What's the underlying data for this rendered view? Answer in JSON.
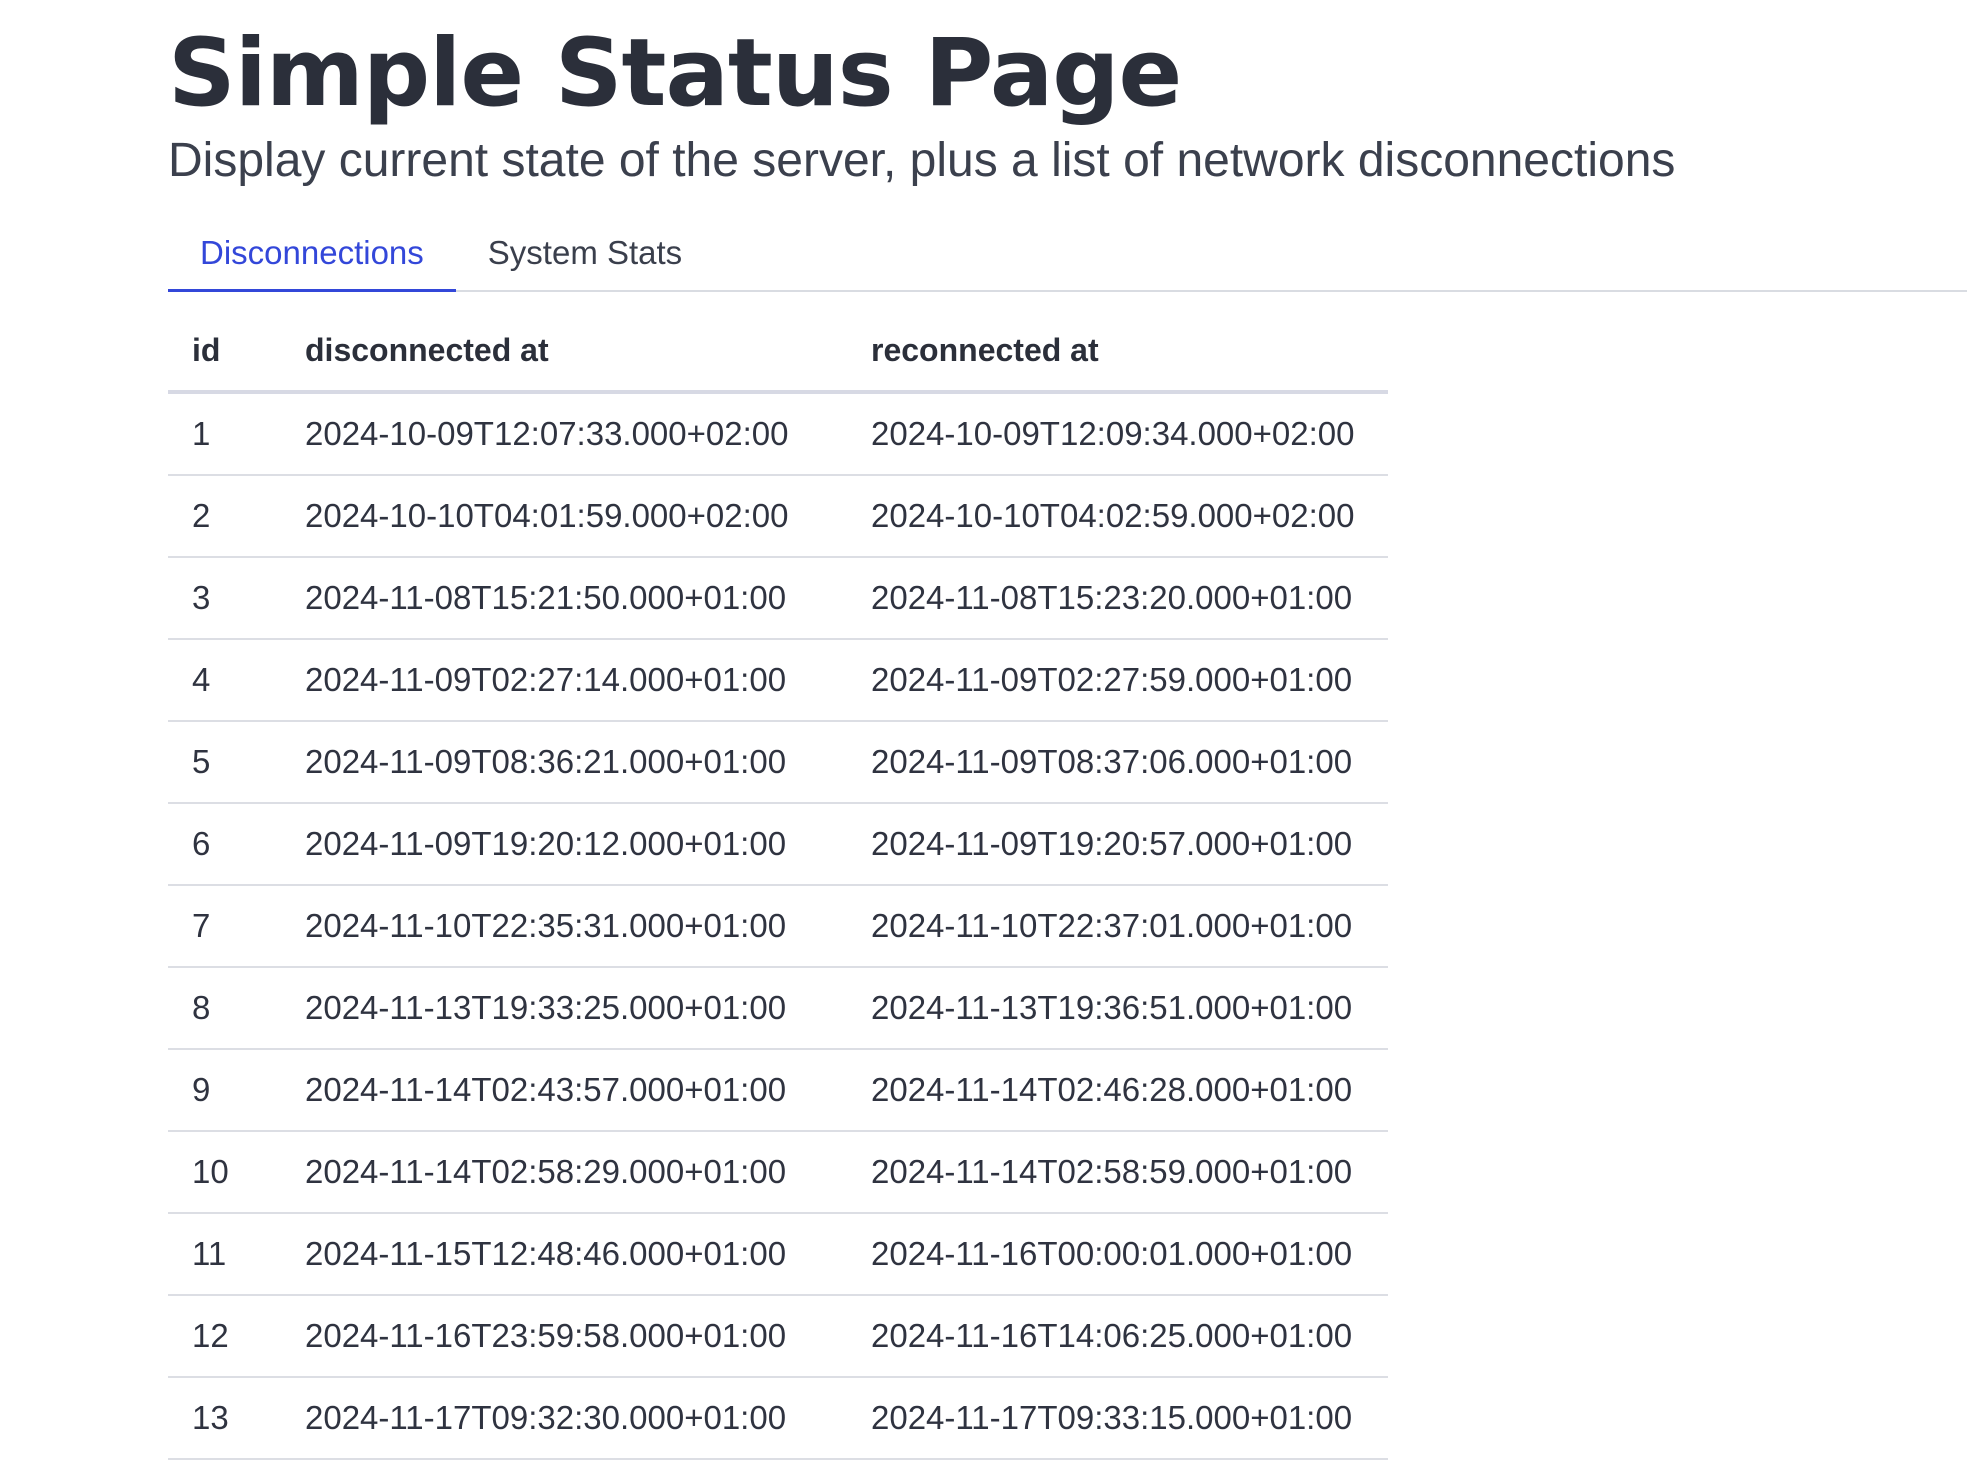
{
  "header": {
    "title": "Simple Status Page",
    "subtitle": "Display current state of the server, plus a list of network disconnections"
  },
  "tabs": [
    {
      "label": "Disconnections",
      "active": true
    },
    {
      "label": "System Stats",
      "active": false
    }
  ],
  "table": {
    "columns": [
      "id",
      "disconnected at",
      "reconnected at"
    ],
    "rows": [
      {
        "id": "1",
        "disconnected_at": "2024-10-09T12:07:33.000+02:00",
        "reconnected_at": "2024-10-09T12:09:34.000+02:00"
      },
      {
        "id": "2",
        "disconnected_at": "2024-10-10T04:01:59.000+02:00",
        "reconnected_at": "2024-10-10T04:02:59.000+02:00"
      },
      {
        "id": "3",
        "disconnected_at": "2024-11-08T15:21:50.000+01:00",
        "reconnected_at": "2024-11-08T15:23:20.000+01:00"
      },
      {
        "id": "4",
        "disconnected_at": "2024-11-09T02:27:14.000+01:00",
        "reconnected_at": "2024-11-09T02:27:59.000+01:00"
      },
      {
        "id": "5",
        "disconnected_at": "2024-11-09T08:36:21.000+01:00",
        "reconnected_at": "2024-11-09T08:37:06.000+01:00"
      },
      {
        "id": "6",
        "disconnected_at": "2024-11-09T19:20:12.000+01:00",
        "reconnected_at": "2024-11-09T19:20:57.000+01:00"
      },
      {
        "id": "7",
        "disconnected_at": "2024-11-10T22:35:31.000+01:00",
        "reconnected_at": "2024-11-10T22:37:01.000+01:00"
      },
      {
        "id": "8",
        "disconnected_at": "2024-11-13T19:33:25.000+01:00",
        "reconnected_at": "2024-11-13T19:36:51.000+01:00"
      },
      {
        "id": "9",
        "disconnected_at": "2024-11-14T02:43:57.000+01:00",
        "reconnected_at": "2024-11-14T02:46:28.000+01:00"
      },
      {
        "id": "10",
        "disconnected_at": "2024-11-14T02:58:29.000+01:00",
        "reconnected_at": "2024-11-14T02:58:59.000+01:00"
      },
      {
        "id": "11",
        "disconnected_at": "2024-11-15T12:48:46.000+01:00",
        "reconnected_at": "2024-11-16T00:00:01.000+01:00"
      },
      {
        "id": "12",
        "disconnected_at": "2024-11-16T23:59:58.000+01:00",
        "reconnected_at": "2024-11-16T14:06:25.000+01:00"
      },
      {
        "id": "13",
        "disconnected_at": "2024-11-17T09:32:30.000+01:00",
        "reconnected_at": "2024-11-17T09:33:15.000+01:00"
      }
    ]
  },
  "colors": {
    "accent": "#3347d9",
    "text": "#2b2f3a",
    "border": "#dcdee4"
  }
}
